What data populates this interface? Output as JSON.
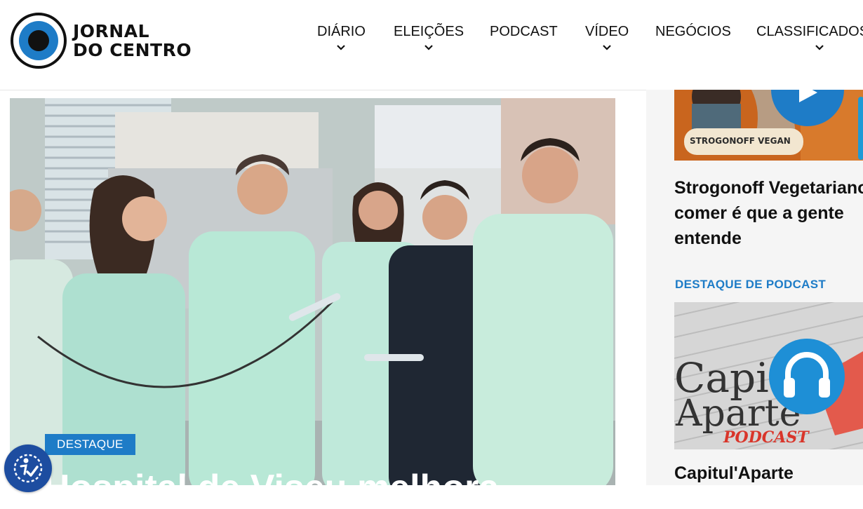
{
  "brand": {
    "line1": "JORNAL",
    "line2": "DO CENTRO",
    "colors": {
      "ring": "#111111",
      "iris": "#1e7cc7",
      "pupil": "#111111"
    }
  },
  "nav": {
    "items": [
      {
        "label": "DIÁRIO",
        "has_dropdown": true
      },
      {
        "label": "ELEIÇÕES",
        "has_dropdown": true
      },
      {
        "label": "PODCAST",
        "has_dropdown": false
      },
      {
        "label": "VÍDEO",
        "has_dropdown": true
      },
      {
        "label": "NEGÓCIOS",
        "has_dropdown": false
      },
      {
        "label": "CLASSIFICADOS",
        "has_dropdown": true
      }
    ]
  },
  "hero": {
    "badge": "DESTAQUE",
    "title": "Hospital de Viseu melhora",
    "image_icon": "photo-medical-team"
  },
  "sidebar": {
    "video_card": {
      "thumb_caption": "STROGONOFF VEGAN",
      "title_lines": [
        "Strogonoff Vegetariano",
        "comer é que a gente",
        "entende"
      ],
      "play_icon": "play-icon"
    },
    "podcast_section_label": "DESTAQUE DE PODCAST",
    "podcast_card": {
      "thumb_text_1": "Capitul'",
      "thumb_text_2": "Aparte",
      "thumb_text_3": "PODCAST",
      "title": "Capitul'Aparte",
      "headphones_icon": "headphones-icon"
    }
  },
  "accessibility": {
    "icon": "accessibility-icon"
  },
  "accent_color": "#1e7cc7"
}
